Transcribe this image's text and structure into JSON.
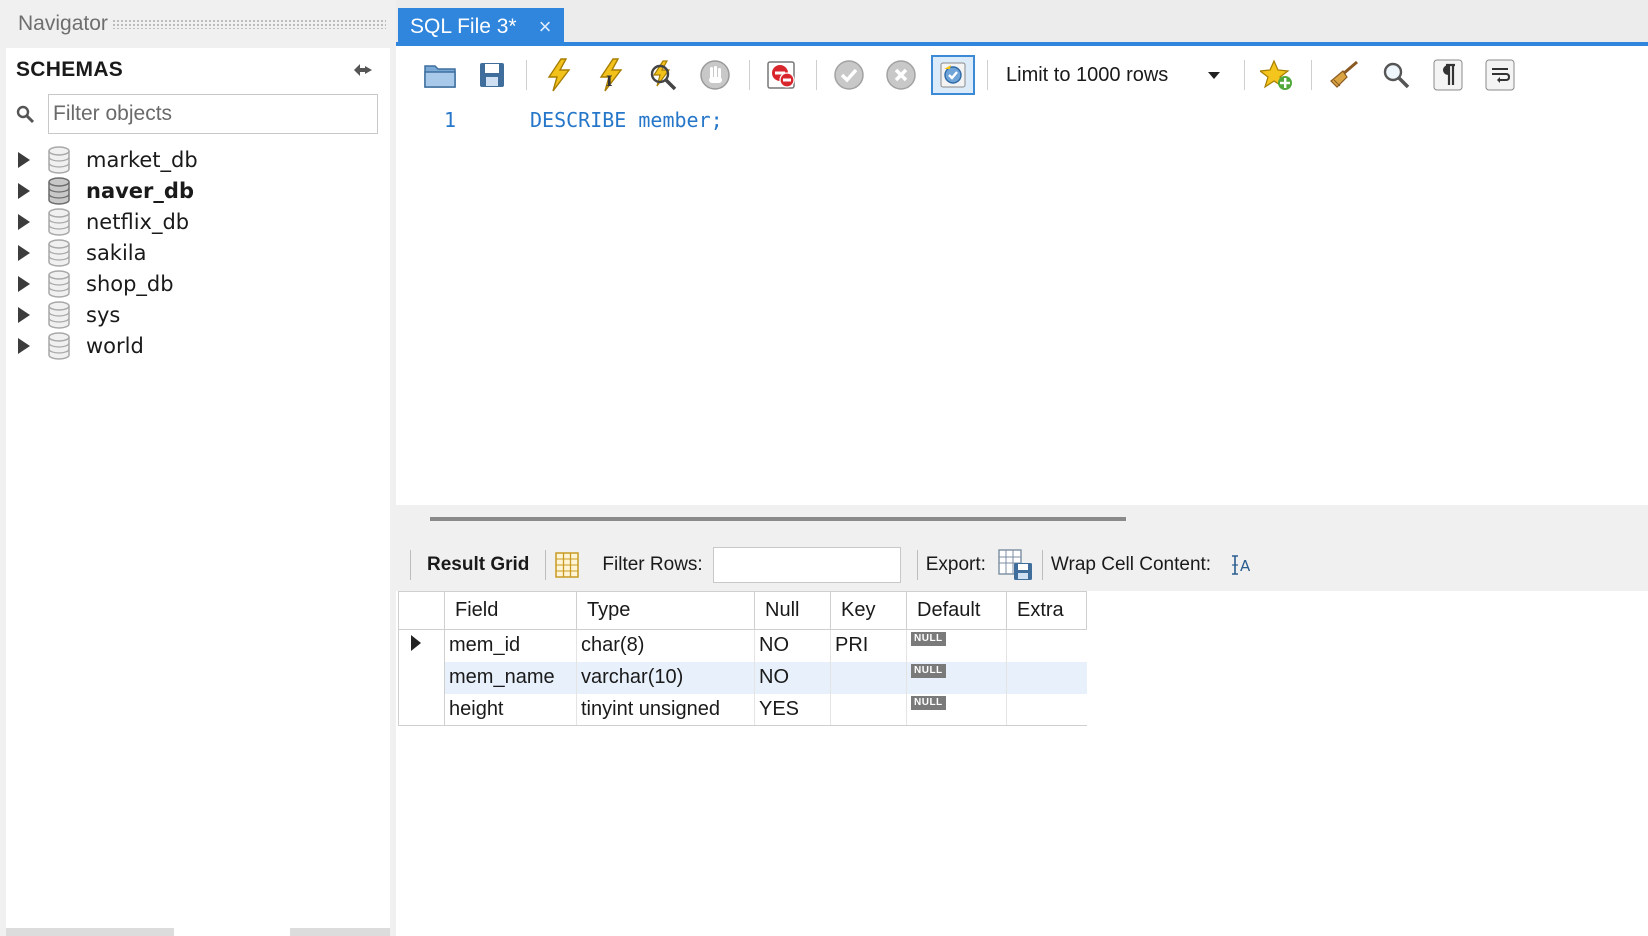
{
  "navigator": {
    "title": "Navigator",
    "schemas_label": "SCHEMAS",
    "filter_placeholder": "Filter objects",
    "schemas": [
      {
        "name": "market_db",
        "active": false
      },
      {
        "name": "naver_db",
        "active": true
      },
      {
        "name": "netflix_db",
        "active": false
      },
      {
        "name": "sakila",
        "active": false
      },
      {
        "name": "shop_db",
        "active": false
      },
      {
        "name": "sys",
        "active": false
      },
      {
        "name": "world",
        "active": false
      }
    ]
  },
  "editor": {
    "tab_label": "SQL File 3*",
    "tab_close": "×",
    "limit_rows": "Limit to 1000 rows",
    "line_number": "1",
    "code": "DESCRIBE member;"
  },
  "result": {
    "grid_label": "Result Grid",
    "filter_rows_label": "Filter Rows:",
    "export_label": "Export:",
    "wrap_label": "Wrap Cell Content:",
    "columns": [
      "Field",
      "Type",
      "Null",
      "Key",
      "Default",
      "Extra"
    ],
    "null_badge": "NULL",
    "rows": [
      [
        "mem_id",
        "char(8)",
        "NO",
        "PRI",
        "NULL",
        ""
      ],
      [
        "mem_name",
        "varchar(10)",
        "NO",
        "",
        "NULL",
        ""
      ],
      [
        "height",
        "tinyint unsigned",
        "YES",
        "",
        "NULL",
        ""
      ]
    ]
  },
  "colors": {
    "accent": "#2f86dc",
    "code_blue": "#2677c9",
    "panel_bg": "#f0f0f0",
    "alt_row": "#e8f0fb"
  }
}
